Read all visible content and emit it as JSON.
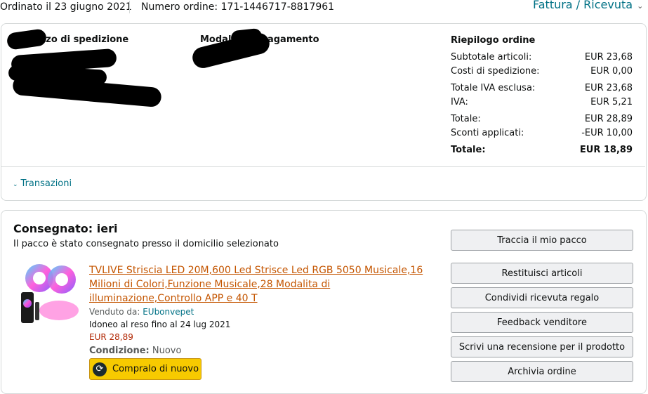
{
  "header": {
    "order_date": "Ordinato il 23 giugno 2021",
    "order_number": "Numero ordine: 171-1446717-8817961",
    "invoice_link": "Fattura / Ricevuta"
  },
  "summary_box": {
    "shipping_address_title": "Indirizzo di spedizione",
    "payment_method_title": "Modalità di pagamento",
    "order_summary": {
      "title": "Riepilogo ordine",
      "rows": [
        {
          "label": "Subtotale articoli:",
          "value": "EUR 23,68"
        },
        {
          "label": "Costi di spedizione:",
          "value": "EUR 0,00"
        },
        {
          "label": "Totale IVA esclusa:",
          "value": "EUR 23,68"
        },
        {
          "label": "IVA:",
          "value": "EUR 5,21"
        },
        {
          "label": "Totale:",
          "value": "EUR 28,89"
        },
        {
          "label": "Sconti applicati:",
          "value": "-EUR 10,00"
        },
        {
          "label": "Totale:",
          "value": "EUR 18,89"
        }
      ]
    },
    "transactions_link": "Transazioni"
  },
  "shipment": {
    "status": "Consegnato: ieri",
    "status_detail": "Il pacco è stato consegnato presso il domicilio selezionato",
    "product": {
      "title": "TVLIVE Striscia LED 20M,600 Led Strisce Led RGB 5050 Musicale,16 Milioni di Colori,Funzione Musicale,28 Modalita di illuminazione,Controllo APP e 40 T",
      "sold_by_label": "Venduto da:",
      "seller": "EUbonvepet",
      "return_info": "Idoneo al reso fino al 24 lug 2021",
      "price": "EUR 28,89",
      "condition_label": "Condizione:",
      "condition_value": "Nuovo",
      "buy_again": "Compralo di nuovo"
    },
    "actions": [
      "Traccia il mio pacco",
      "Restituisci articoli",
      "Condividi ricevuta regalo",
      "Feedback venditore",
      "Scrivi una recensione per il prodotto",
      "Archivia ordine"
    ]
  },
  "colors": {
    "link": "#007185",
    "product_link": "#c45500",
    "price": "#b12704",
    "buy_button": "#f7ca00"
  }
}
